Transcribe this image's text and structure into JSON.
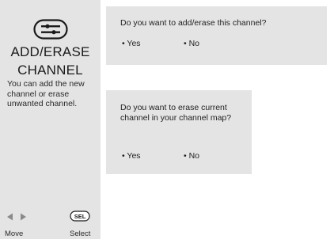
{
  "sidebar": {
    "icon": "remote-control-icon",
    "title_line1": "ADD/ERASE",
    "title_line2": "CHANNEL",
    "description": "You can add the new channel or erase unwanted channel.",
    "nav_icon": "left-right-arrows-icon",
    "select_icon": "sel-button-icon",
    "move_label": "Move",
    "select_label": "Select"
  },
  "dialog1": {
    "question": "Do you want to add/erase this channel?",
    "options": [
      "• Yes",
      "• No"
    ]
  },
  "dialog2": {
    "question": "Do you want to erase current channel in your channel map?",
    "options": [
      "• Yes",
      "• No"
    ]
  }
}
